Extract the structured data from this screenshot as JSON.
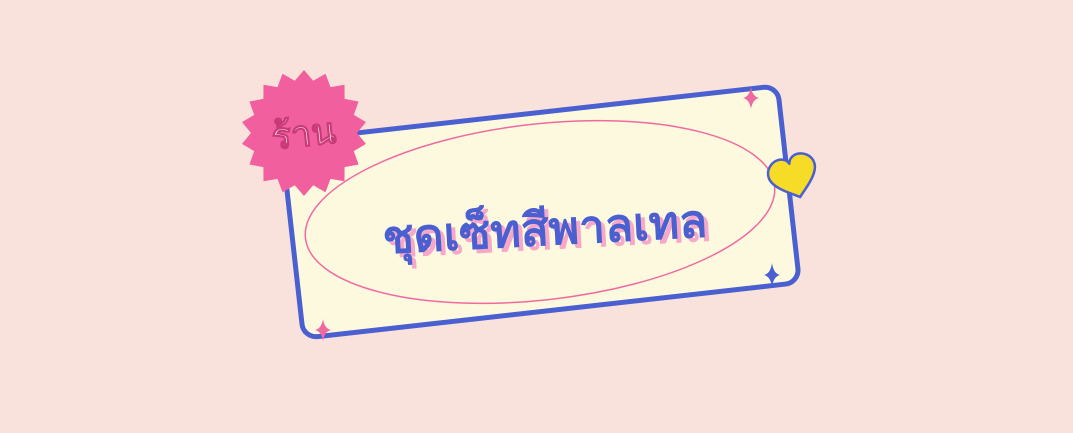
{
  "badge": {
    "label": "ร้าน"
  },
  "sign": {
    "title": "ชุดเซ็ทสีพาลเทล"
  },
  "colors": {
    "background": "#f9e1dc",
    "card_fill": "#fdf9df",
    "card_border": "#4a5fd0",
    "ellipse_stroke": "#f06aa0",
    "badge_fill": "#f25f9f",
    "badge_text": "#fdf2d8",
    "title_text": "#4a5fd0",
    "title_shadow": "#f7a7c8",
    "heart_fill": "#f6dc26",
    "sparkle_pink": "#f06aa0",
    "sparkle_blue": "#4a5fd0"
  }
}
